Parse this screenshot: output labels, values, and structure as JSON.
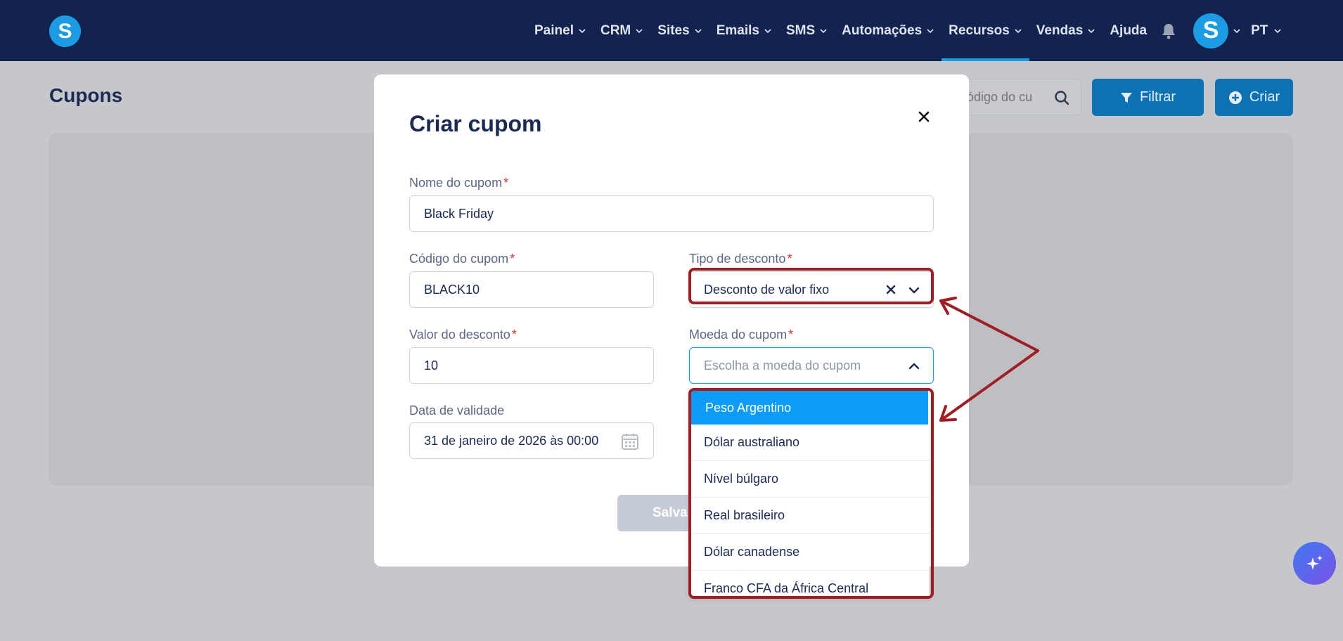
{
  "nav": {
    "items": [
      {
        "label": "Painel",
        "chevron": true
      },
      {
        "label": "CRM",
        "chevron": true
      },
      {
        "label": "Sites",
        "chevron": true
      },
      {
        "label": "Emails",
        "chevron": true
      },
      {
        "label": "SMS",
        "chevron": true
      },
      {
        "label": "Automações",
        "chevron": true
      },
      {
        "label": "Recursos",
        "chevron": true
      },
      {
        "label": "Vendas",
        "chevron": true
      },
      {
        "label": "Ajuda",
        "chevron": false
      }
    ],
    "active_index": 6,
    "logo_letter": "S",
    "avatar_letter": "S",
    "language": "PT"
  },
  "page": {
    "title": "Cupons",
    "search_placeholder": "u código do cu",
    "filter_label": "Filtrar",
    "create_label": "Criar"
  },
  "modal": {
    "title": "Criar cupom",
    "name_label": "Nome do cupom",
    "name_value": "Black Friday",
    "code_label": "Código do cupom",
    "code_value": "BLACK10",
    "discount_type_label": "Tipo de desconto",
    "discount_type_value": "Desconto de valor fixo",
    "discount_value_label": "Valor do desconto",
    "discount_value": "10",
    "currency_label": "Moeda do cupom",
    "currency_placeholder": "Escolha a moeda do cupom",
    "expiry_label": "Data de validade",
    "expiry_value": "31 de janeiro de 2026 às 00:00",
    "save_label": "Salvar",
    "required_mark": "*"
  },
  "currency_options": [
    "Peso Argentino",
    "Dólar australiano",
    "Nível búlgaro",
    "Real brasileiro",
    "Dólar canadense",
    "Franco CFA da África Central"
  ],
  "currency_selected_index": 0,
  "colors": {
    "nav_bg": "#13234f",
    "accent": "#1a9be4",
    "selected_option": "#0c9cf7",
    "annotation": "#a11d24",
    "required": "#e0303a"
  }
}
